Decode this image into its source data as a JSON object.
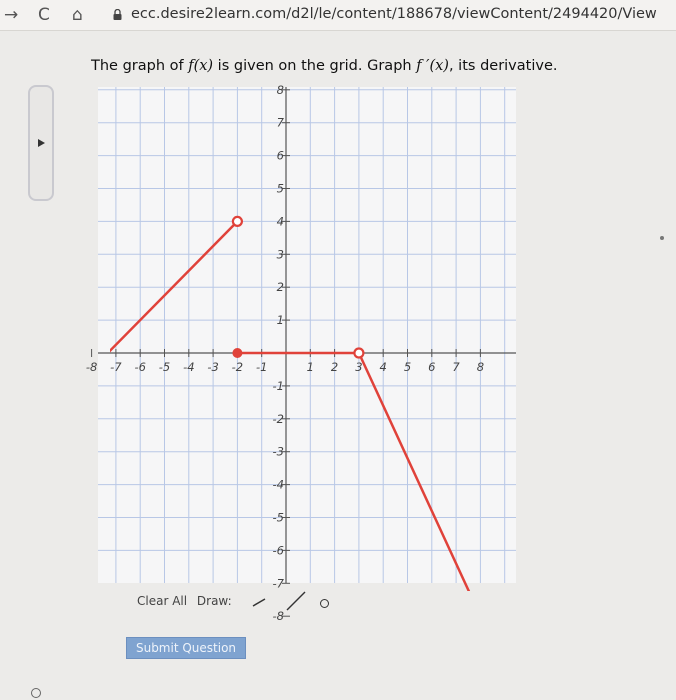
{
  "browser": {
    "back_symbol": "→",
    "reload_symbol": "C",
    "home_symbol": "⌂",
    "url": "ecc.desire2learn.com/d2l/le/content/188678/viewContent/2494420/View"
  },
  "question": {
    "prefix": "The graph of ",
    "fname": "f(x)",
    "middle": " is given on the grid. Graph ",
    "fprime": "f ′(x)",
    "suffix": ", its derivative."
  },
  "graph": {
    "xmin": -8,
    "xmax": 8,
    "ymin": -8,
    "ymax": 8,
    "x_tick_labels": [
      "-8",
      "-7",
      "-6",
      "-5",
      "-4",
      "-3",
      "-2",
      "-1",
      "1",
      "2",
      "3",
      "4",
      "5",
      "6",
      "7",
      "8"
    ],
    "y_tick_labels": [
      "8",
      "7",
      "6",
      "5",
      "4",
      "3",
      "2",
      "1",
      "-1",
      "-2",
      "-3",
      "-4",
      "-5",
      "-6",
      "-7",
      "-8"
    ],
    "grid_color": "#b8c7e6",
    "curve_color": "#e0423a",
    "segments": [
      {
        "from": [
          -10,
          -2
        ],
        "to": [
          -2,
          4
        ],
        "end_open": true
      },
      {
        "from": [
          -2,
          0
        ],
        "to": [
          3,
          0
        ],
        "start_closed": true,
        "end_open": true
      },
      {
        "from": [
          3,
          0
        ],
        "to": [
          8,
          -8
        ]
      }
    ]
  },
  "toolbar": {
    "clear_label": "Clear All",
    "draw_label": "Draw:"
  },
  "submit_label": "Submit Question"
}
